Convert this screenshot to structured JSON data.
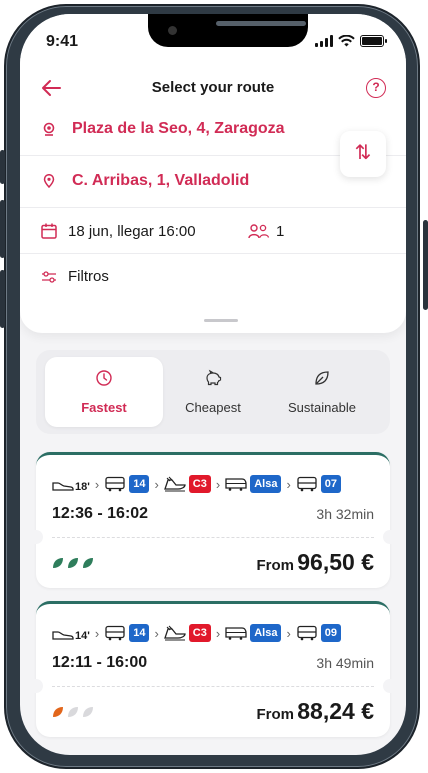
{
  "status": {
    "time": "9:41"
  },
  "header": {
    "title": "Select your route",
    "help_label": "?"
  },
  "route": {
    "origin": "Plaza de la Seo, 4, Zaragoza",
    "destination": "C. Arribas, 1, Valladolid",
    "swap_label": "⇅"
  },
  "trip": {
    "date": "18 jun, llegar 16:00",
    "passengers": "1"
  },
  "filters": {
    "label": "Filtros"
  },
  "sort": {
    "tabs": [
      {
        "label": "Fastest",
        "active": true
      },
      {
        "label": "Cheapest",
        "active": false
      },
      {
        "label": "Sustainable",
        "active": false
      }
    ]
  },
  "colors": {
    "accent": "#d12b55",
    "teal": "#2b6e64",
    "line_blue": "#1e67c9",
    "line_red": "#e1192b",
    "leaf_green": "#2e7d5b",
    "leaf_orange": "#e2661b",
    "leaf_off": "#d9d9dc"
  },
  "results": [
    {
      "walk_minutes": "18'",
      "lines": [
        "14",
        "C3",
        "Alsa",
        "07"
      ],
      "times": "12:36 - 16:02",
      "duration": "3h 32min",
      "price_prefix": "From",
      "price": "96,50 €",
      "eco_level": 3
    },
    {
      "walk_minutes": "14'",
      "lines": [
        "14",
        "C3",
        "Alsa",
        "09"
      ],
      "times": "12:11 - 16:00",
      "duration": "3h 49min",
      "price_prefix": "From",
      "price": "88,24 €",
      "eco_level": 1
    }
  ]
}
